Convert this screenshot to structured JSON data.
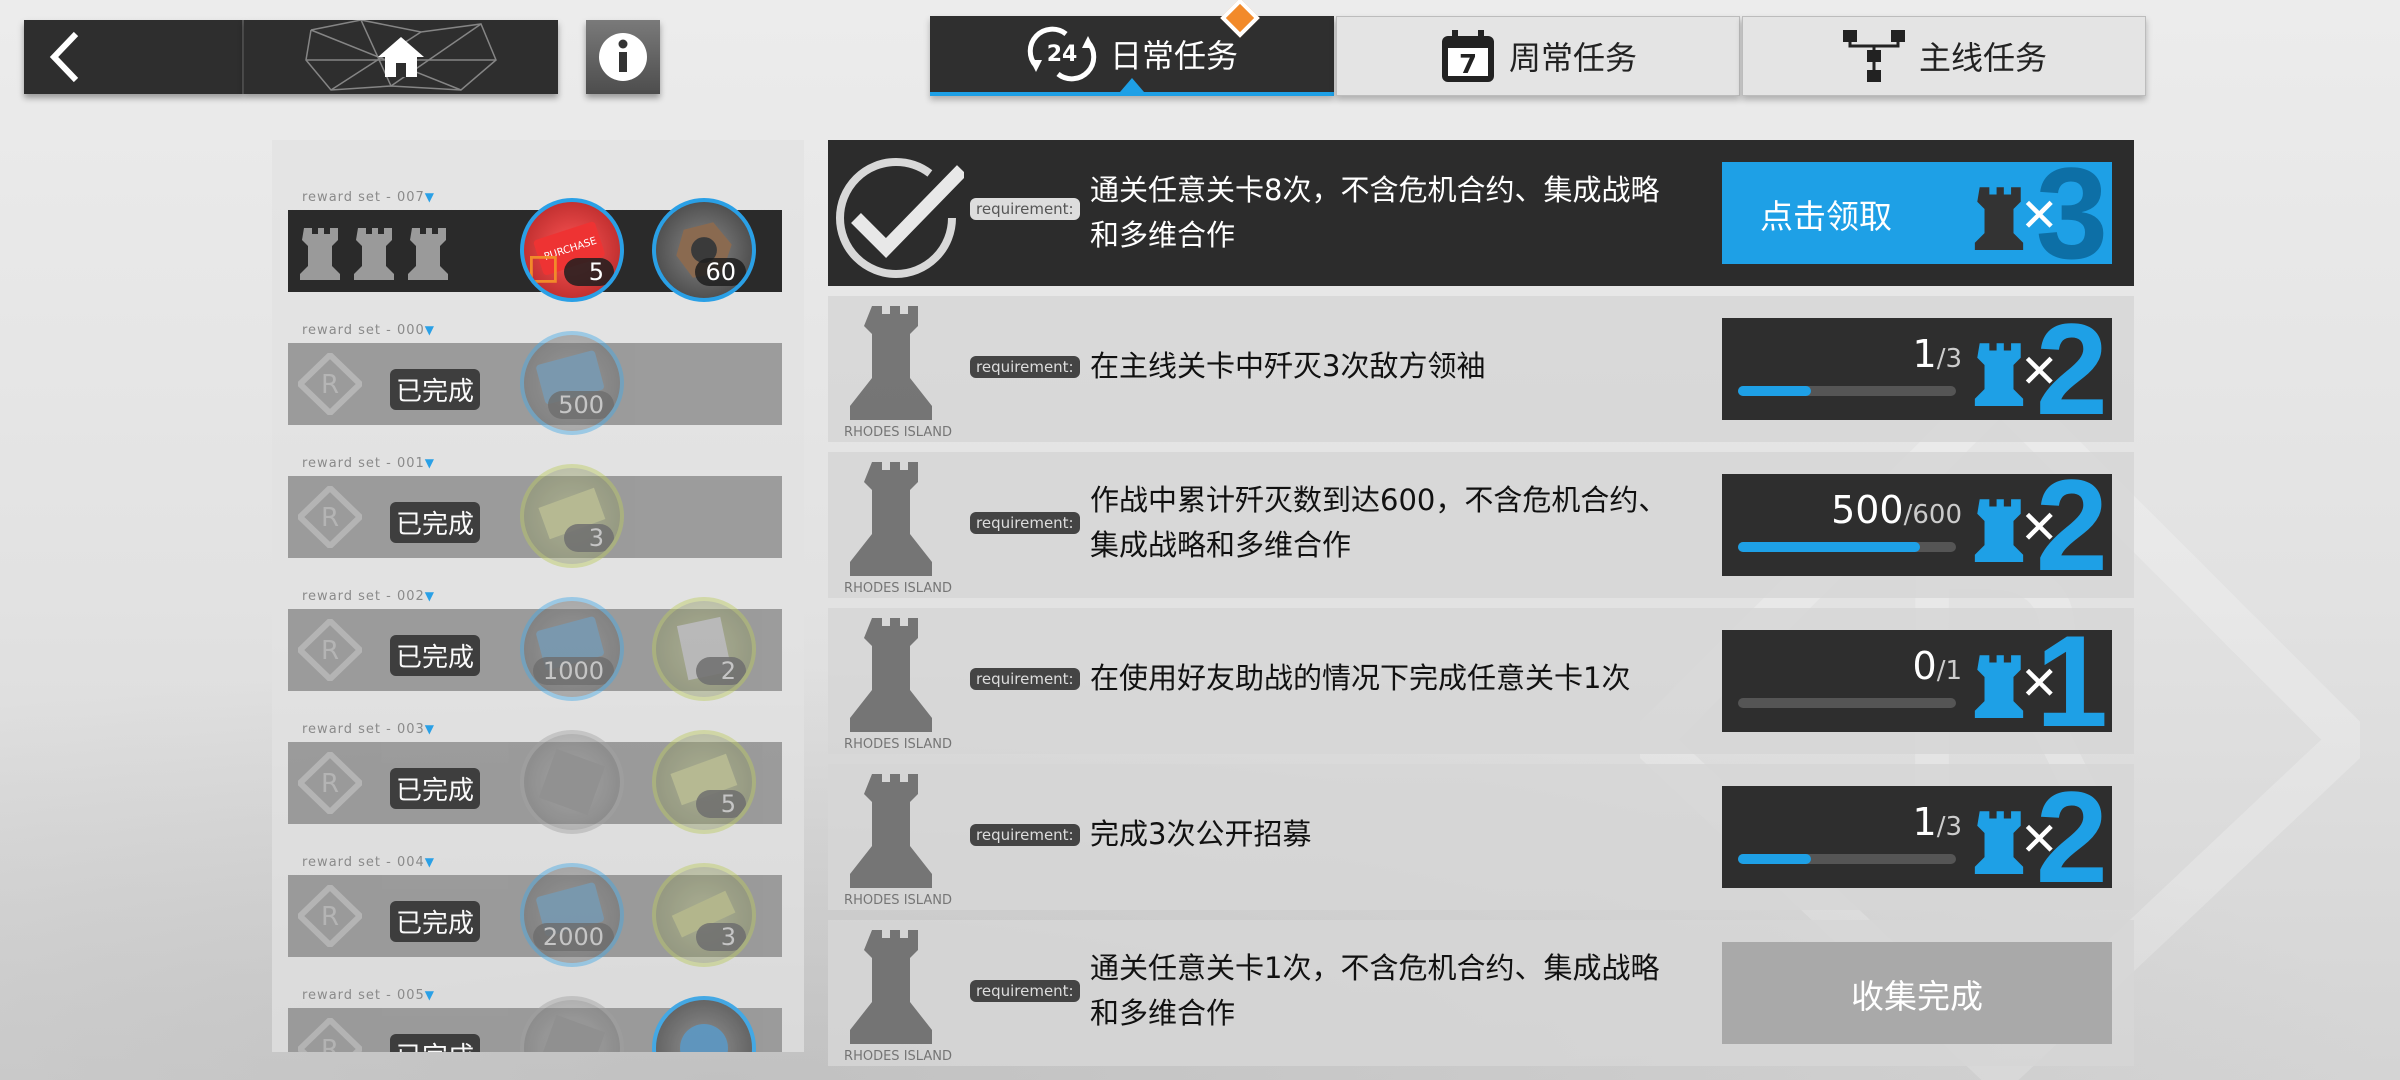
{
  "tabs": [
    {
      "label": "日常任务",
      "icon": "refresh-24-icon",
      "badge": "24",
      "active": true
    },
    {
      "label": "周常任务",
      "icon": "calendar-7-icon",
      "badge": "7",
      "active": false
    },
    {
      "label": "主线任务",
      "icon": "tree-icon",
      "active": false
    }
  ],
  "reward_sets": [
    {
      "label": "reward  set - 007",
      "status": "active",
      "items": [
        {
          "icon": "purchase-certificate-icon",
          "count": "5"
        },
        {
          "icon": "hex-nut-icon",
          "count": "60"
        }
      ]
    },
    {
      "label": "reward  set - 000",
      "status": "已完成",
      "items": [
        {
          "icon": "exp-card-icon",
          "count": "500"
        }
      ]
    },
    {
      "label": "reward  set - 001",
      "status": "已完成",
      "items": [
        {
          "icon": "recruitment-permit-icon",
          "count": "3"
        }
      ]
    },
    {
      "label": "reward  set - 002",
      "status": "已完成",
      "items": [
        {
          "icon": "exp-card-icon",
          "count": "1000"
        },
        {
          "icon": "device-icon",
          "count": "2"
        }
      ]
    },
    {
      "label": "reward  set - 003",
      "status": "已完成",
      "items": [
        {
          "icon": "crate-icon",
          "count": ""
        },
        {
          "icon": "recruitment-permit-icon",
          "count": "5"
        }
      ]
    },
    {
      "label": "reward  set - 004",
      "status": "已完成",
      "items": [
        {
          "icon": "exp-card-icon",
          "count": "2000"
        },
        {
          "icon": "ticket-icon",
          "count": "3"
        }
      ]
    },
    {
      "label": "reward  set - 005",
      "status": "已完成",
      "items": [
        {
          "icon": "crate-icon",
          "count": ""
        },
        {
          "icon": "blue-item-icon",
          "count": ""
        }
      ]
    }
  ],
  "requirement_tag": "requirement:",
  "tasks": [
    {
      "desc": [
        "通关任意关卡8次，不含危机合约、集成战略",
        "和多维合作"
      ],
      "state": "claim",
      "action": "点击领取",
      "reward": "3",
      "dark": true
    },
    {
      "desc": [
        "在主线关卡中歼灭3次敌方领袖"
      ],
      "state": "progress",
      "current": "1",
      "total": "/3",
      "fraction": 0.333,
      "reward": "2"
    },
    {
      "desc": [
        "作战中累计歼灭数到达600，不含危机合约、",
        "集成战略和多维合作"
      ],
      "state": "progress",
      "current": "500",
      "total": "/600",
      "fraction": 0.833,
      "reward": "2"
    },
    {
      "desc": [
        "在使用好友助战的情况下完成任意关卡1次"
      ],
      "state": "progress",
      "current": "0",
      "total": "/1",
      "fraction": 0,
      "reward": "1"
    },
    {
      "desc": [
        "完成3次公开招募"
      ],
      "state": "progress",
      "current": "1",
      "total": "/3",
      "fraction": 0.333,
      "reward": "2"
    },
    {
      "desc": [
        "通关任意关卡1次，不含危机合约、集成战略",
        "和多维合作"
      ],
      "state": "collected",
      "action": "收集完成"
    }
  ],
  "colors": {
    "accent": "#1ea0e6",
    "dark": "#2c2c2c",
    "notif": "#f28a2a"
  }
}
